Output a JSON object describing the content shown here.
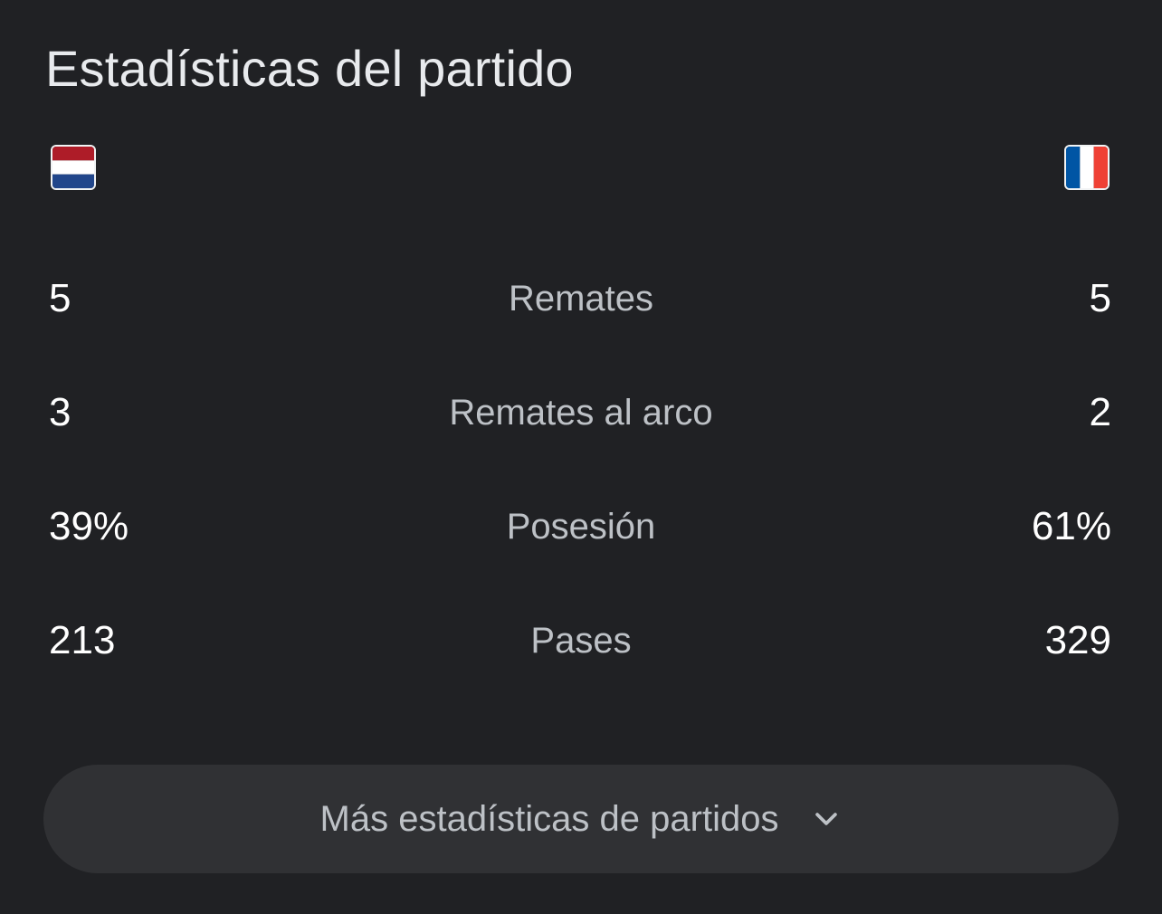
{
  "header": {
    "title": "Estadísticas del partido"
  },
  "teams": {
    "left": {
      "flag_icon": "netherlands-flag-icon",
      "colors": [
        "#AE1C28",
        "#FFFFFF",
        "#21468B"
      ]
    },
    "right": {
      "flag_icon": "france-flag-icon",
      "colors": [
        "#0055A4",
        "#FFFFFF",
        "#EF4135"
      ]
    }
  },
  "stats": [
    {
      "label": "Remates",
      "left": "5",
      "right": "5"
    },
    {
      "label": "Remates al arco",
      "left": "3",
      "right": "2"
    },
    {
      "label": "Posesión",
      "left": "39%",
      "right": "61%"
    },
    {
      "label": "Pases",
      "left": "213",
      "right": "329"
    }
  ],
  "more_button": {
    "label": "Más estadísticas de partidos",
    "icon": "chevron-down-icon"
  },
  "colors": {
    "background": "#202124",
    "button_background": "#303134",
    "primary_text": "#E8EAED",
    "secondary_text": "#BDC1C6"
  }
}
